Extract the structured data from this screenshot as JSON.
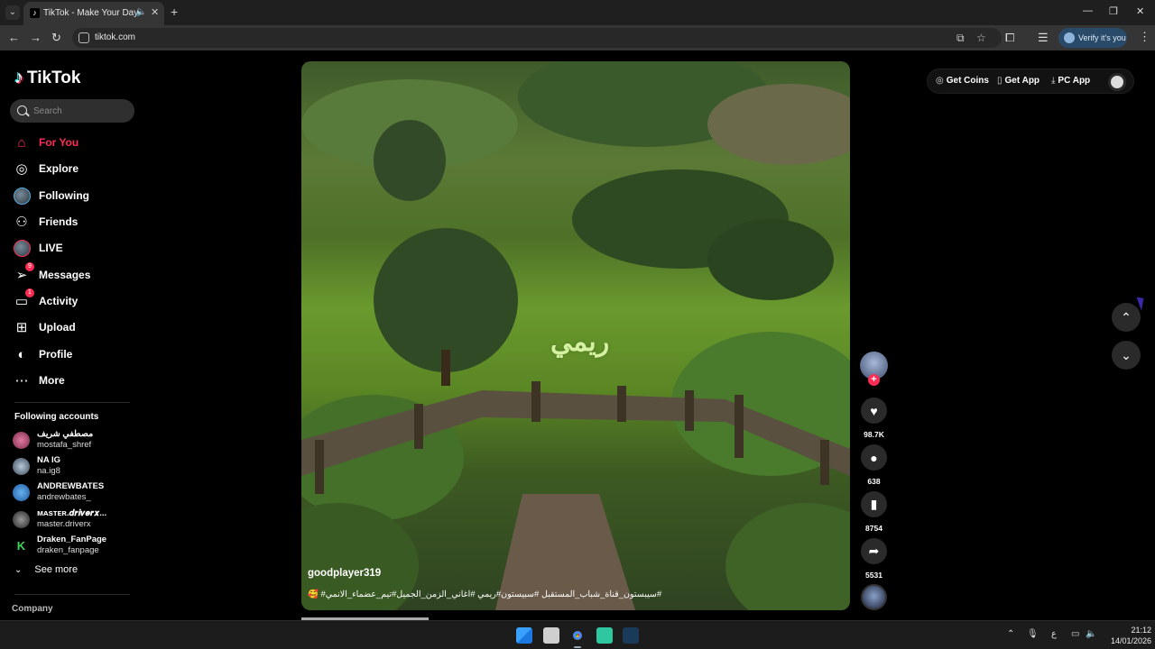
{
  "browser": {
    "tab_title": "TikTok - Make Your Day",
    "url": "tiktok.com",
    "verify_label": "Verify it's you"
  },
  "sidebar": {
    "logo_text": "TikTok",
    "search_placeholder": "Search",
    "nav": [
      {
        "label": "For You",
        "icon": "home-icon",
        "active": true
      },
      {
        "label": "Explore",
        "icon": "compass-icon"
      },
      {
        "label": "Following",
        "icon": "following-avatar-icon"
      },
      {
        "label": "Friends",
        "icon": "friends-icon"
      },
      {
        "label": "LIVE",
        "icon": "live-avatar-icon"
      },
      {
        "label": "Messages",
        "icon": "messages-icon",
        "badge": "9"
      },
      {
        "label": "Activity",
        "icon": "activity-icon",
        "badge": "1"
      },
      {
        "label": "Upload",
        "icon": "upload-icon"
      },
      {
        "label": "Profile",
        "icon": "profile-icon"
      },
      {
        "label": "More",
        "icon": "more-icon"
      }
    ],
    "following_title": "Following accounts",
    "accounts": [
      {
        "name": "مصطفي شريف",
        "handle": "mostafa_shref"
      },
      {
        "name": "NA IG",
        "handle": "na.ig8"
      },
      {
        "name": "ANDREWBATES",
        "handle": "andrewbates_"
      },
      {
        "name": "ᴍᴀsᴛᴇʀ.𝒅𝒓𝒊𝒗𝒆𝒓𝒙...",
        "handle": "master.driverx"
      },
      {
        "name": "Draken_FanPage",
        "handle": "draken_fanpage"
      }
    ],
    "see_more": "See more",
    "company": "Company"
  },
  "video": {
    "overlay_text": "ريمي",
    "author": "goodplayer319",
    "description": "#سيبستون_قناة_شباب_المستقبل #سبيستون#ريمي #اغاني_الزمن_الجميل#تيم_عضماء_الانمي# 🥰"
  },
  "actions": {
    "likes": "98.7K",
    "comments": "638",
    "saves": "8754",
    "shares": "5531"
  },
  "top_actions": {
    "get_coins": "Get Coins",
    "get_app": "Get App",
    "pc_app": "PC App"
  },
  "taskbar": {
    "time": "21:12",
    "date": "14/01/2026",
    "lang": "ع"
  },
  "colors": {
    "accent": "#fe2c55",
    "background": "#000000"
  }
}
